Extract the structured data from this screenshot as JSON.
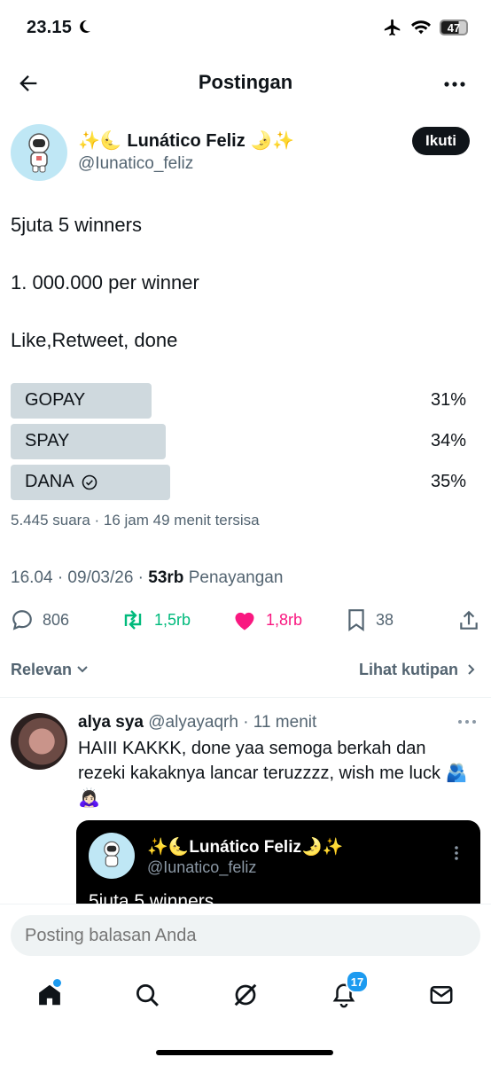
{
  "status_bar": {
    "time": "23.15",
    "battery": "47"
  },
  "header": {
    "title": "Postingan"
  },
  "post": {
    "author_name": "✨🌜 Lunático Feliz 🌛✨",
    "handle": "@Iunatico_feliz",
    "follow_label": "Ikuti",
    "lines": [
      "5juta 5 winners",
      "1. 000.000 per winner",
      "Like,Retweet, done"
    ]
  },
  "poll": {
    "options": [
      {
        "label": "GOPAY",
        "percent_text": "31%",
        "percent": 31,
        "selected": false
      },
      {
        "label": "SPAY",
        "percent_text": "34%",
        "percent": 34,
        "selected": false
      },
      {
        "label": "DANA",
        "percent_text": "35%",
        "percent": 35,
        "selected": true
      }
    ],
    "meta": "5.445 suara · 16 jam 49 menit tersisa"
  },
  "timestamp": {
    "datetime": "16.04 · 09/03/26 · ",
    "views_count": "53rb",
    "views_label": " Penayangan"
  },
  "actions": {
    "replies": "806",
    "reposts": "1,5rb",
    "likes": "1,8rb",
    "bookmarks": "38"
  },
  "sort": {
    "label": "Relevan",
    "quotes_label": "Lihat kutipan"
  },
  "reply": {
    "name": "alya sya",
    "meta": " @alyayaqrh · 11 menit",
    "text": "HAIII KAKKK, done yaa semoga berkah dan rezeki kakaknya lancar teruzzzz, wish me luck 🫂🙇🏻‍♀️"
  },
  "quote": {
    "name": "✨🌜Lunático Feliz🌛✨",
    "handle": "@Iunatico_feliz",
    "preview": "5juta 5 winners"
  },
  "composer": {
    "placeholder": "Posting balasan Anda"
  },
  "nav": {
    "notifications_badge": "17"
  },
  "colors": {
    "accent": "#1d9bf0",
    "repost_green": "#00ba7c",
    "like_pink": "#f91880",
    "poll_bar": "#cfd9de"
  }
}
